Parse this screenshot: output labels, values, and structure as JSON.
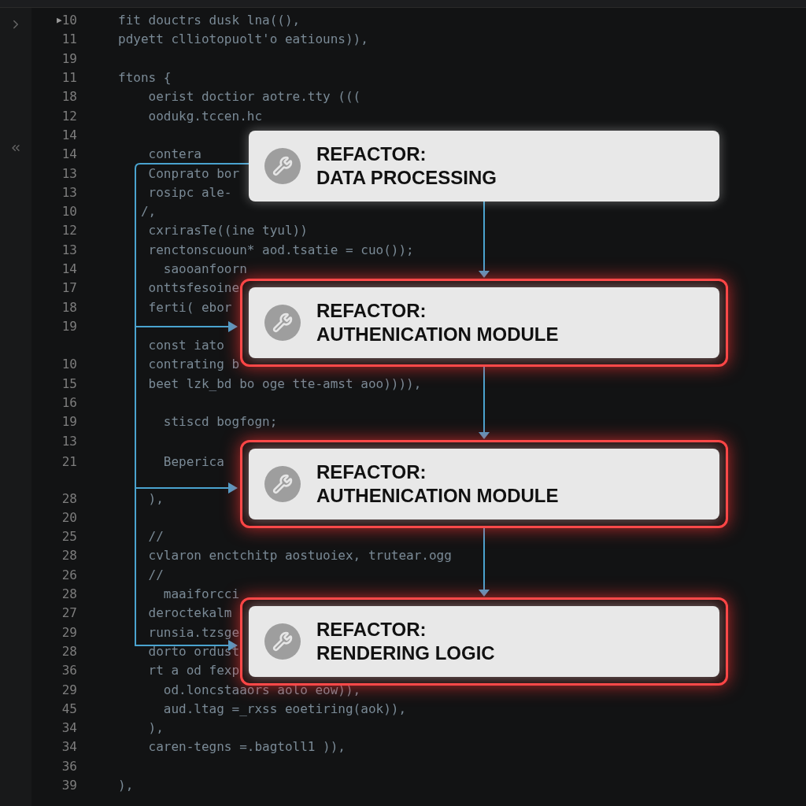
{
  "editor": {
    "lines": [
      {
        "number": "10",
        "marker": "▶",
        "code": "fit douctrs dusk lna((),"
      },
      {
        "number": "11",
        "code": "pdyett clliotopuolt'o eatiouns)),"
      },
      {
        "number": "19"
      },
      {
        "number": "11",
        "code": "ftons {"
      },
      {
        "number": "18",
        "code": "    oerist doctior aotre.tty ((("
      },
      {
        "number": "12",
        "code": "    oodukg.tccen.hc"
      },
      {
        "number": "14"
      },
      {
        "number": "14",
        "code": "    contera"
      },
      {
        "number": "13",
        "code": "    Conprato bor"
      },
      {
        "number": "13",
        "code": "    rosipc ale-"
      },
      {
        "number": "10",
        "code": "   /,"
      },
      {
        "number": "12",
        "code": "    cxrirasTe((ine tyul))"
      },
      {
        "number": "13",
        "code": "    renctonscuoun* aod.tsatie = cuo());"
      },
      {
        "number": "14",
        "code": "      saooanfoorn"
      },
      {
        "number": "17",
        "code": "    onttsfesoine"
      },
      {
        "number": "18",
        "code": "    ferti( ebor"
      },
      {
        "number": "19"
      },
      {
        "code": "    const iato"
      },
      {
        "number": "10",
        "code": "    contrating b"
      },
      {
        "number": "15",
        "code": "    beet lzk_bd bo oge tte-amst aoo)))),"
      },
      {
        "number": "16"
      },
      {
        "number": "19",
        "code": "      stiscd bogfogn;"
      },
      {
        "number": "13"
      },
      {
        "number": "21",
        "code": "      Beperica",
        "spacer_after": true
      },
      {
        "number": "28",
        "code": "    ),"
      },
      {
        "number": "20"
      },
      {
        "number": "25",
        "code": "    //"
      },
      {
        "number": "28",
        "code": "    cvlaron enctchitp aostuoiex, trutear.ogg"
      },
      {
        "number": "26",
        "code": "    //"
      },
      {
        "number": "28",
        "code": "      maaiforcci"
      },
      {
        "number": "27",
        "code": "    deroctekalm"
      },
      {
        "number": "29",
        "code": "    runsia.tzsge"
      },
      {
        "number": "28",
        "code": "    dorto ordust"
      },
      {
        "number": "36",
        "code": "    rt a od fexp"
      },
      {
        "number": "29",
        "code": "      od.loncstaaors aolo eow)),"
      },
      {
        "number": "45",
        "code": "      aud.ltag =_rxss eoetiring(aok)),"
      },
      {
        "number": "34",
        "code": "    ),"
      },
      {
        "number": "34",
        "code": "    caren-tegns =.bagtoll1 )),"
      },
      {
        "number": "36"
      },
      {
        "number": "39",
        "code": "),"
      }
    ]
  },
  "cards": [
    {
      "label": "REFACTOR:",
      "name": "DATA PROCESSING",
      "highlighted": false
    },
    {
      "label": "REFACTOR:",
      "name": "AUTHENICATION MODULE",
      "highlighted": true
    },
    {
      "label": "REFACTOR:",
      "name": "AUTHENICATION MODULE",
      "highlighted": true
    },
    {
      "label": "REFACTOR:",
      "name": "RENDERING LOGIC",
      "highlighted": true
    }
  ]
}
